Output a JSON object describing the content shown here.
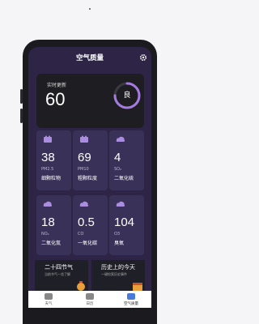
{
  "header": {
    "title": "空气质量"
  },
  "realtime": {
    "label": "实时更新",
    "value": "60",
    "quality": "良"
  },
  "ring": {
    "fraction": 0.75,
    "color": "#a47be0"
  },
  "tiles": [
    {
      "value": "38",
      "code": "PM2.5",
      "name": "细颗粒物",
      "icon": "pm-dots-icon"
    },
    {
      "value": "69",
      "code": "PM10",
      "name": "粗颗粒度",
      "icon": "pm-dots-icon"
    },
    {
      "value": "4",
      "code": "SO₂",
      "name": "二氧化硫",
      "icon": "cloud-icon"
    },
    {
      "value": "18",
      "code": "NO₂",
      "name": "二氧化氮",
      "icon": "cloud-icon"
    },
    {
      "value": "0.5",
      "code": "CO",
      "name": "一氧化碳",
      "icon": "cloud-icon"
    },
    {
      "value": "104",
      "code": "O3",
      "name": "臭氧",
      "icon": "cloud-icon"
    }
  ],
  "cards": [
    {
      "title": "二十四节气",
      "subtitle": "当前节气一览了解"
    },
    {
      "title": "历史上的今天",
      "subtitle": "一键检索历史事件"
    }
  ],
  "tabs": [
    {
      "label": "天气",
      "icon": "weather-tab-icon",
      "active": false
    },
    {
      "label": "日历",
      "icon": "calendar-tab-icon",
      "active": false
    },
    {
      "label": "空气质量",
      "icon": "air-tab-icon",
      "active": true
    }
  ],
  "colors": {
    "screen_bg": "#2d2446",
    "tile_bg": "#3a3158",
    "accent": "#a47be0",
    "tab_active": "#4a7ad9"
  }
}
